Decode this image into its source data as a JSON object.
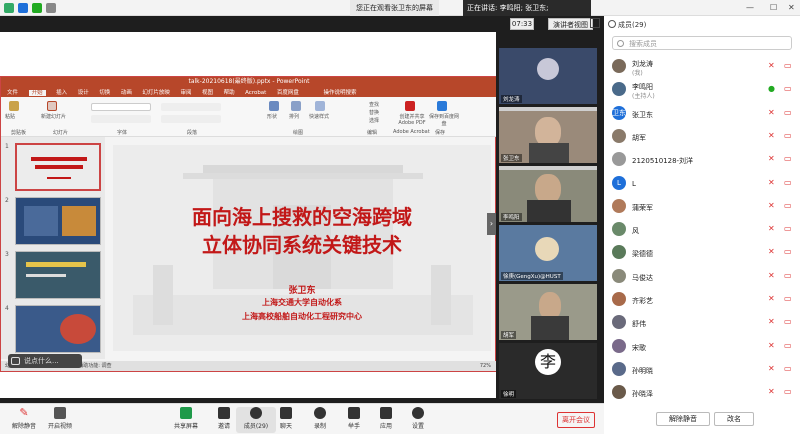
{
  "top": {
    "viewing_banner": "您正在观看张卫东的屏幕",
    "speaking": "正在讲话: 李鸣阳; 张卫东;",
    "clock": "07:33",
    "view_mode": "演讲者视图"
  },
  "ppt": {
    "title": "talk-20210618(最终版).pptx - PowerPoint",
    "tabs": [
      "文件",
      "开始",
      "插入",
      "设计",
      "切换",
      "动画",
      "幻灯片放映",
      "审阅",
      "视图",
      "帮助",
      "Acrobat",
      "百度网盘"
    ],
    "active_tab": "开始",
    "tell_me": "操作说明搜索",
    "ribbon_groups": [
      "剪贴板",
      "幻灯片",
      "字体",
      "段落",
      "绘图",
      "编辑",
      "Adobe Acrobat",
      "保存"
    ],
    "ribbon_buttons": [
      "粘贴",
      "新建幻灯片",
      "形状",
      "排列",
      "快速样式",
      "查找",
      "替换",
      "选择",
      "创建并共享 Adobe PDF",
      "保存到百度网盘"
    ],
    "thumb_numbers": [
      "1",
      "2",
      "3",
      "4"
    ],
    "slide": {
      "title_line1": "面向海上搜救的空海跨域",
      "title_line2": "立体协同系统关键技术",
      "author": "张卫东",
      "affiliation1": "上海交通大学自动化系",
      "affiliation2": "上海高校船舶自动化工程研究中心"
    },
    "status_left": "幻灯片 第1张，共 ...  中文(中国)  辅助功能: 调查",
    "zoom": "72%"
  },
  "chat_hint": "说点什么...",
  "videos": [
    {
      "name": "刘龙涛"
    },
    {
      "name": "张卫东"
    },
    {
      "name": "李鸣阳"
    },
    {
      "name": "徐庚(GengXu)@HUST"
    },
    {
      "name": "胡军"
    },
    {
      "name": "徐明"
    }
  ],
  "panel": {
    "title": "成员(29)",
    "search_placeholder": "搜索成员",
    "members": [
      {
        "name": "刘龙涛",
        "sub": "(我)",
        "avatar": "",
        "color": "#7a6a5a"
      },
      {
        "name": "李鸣阳",
        "sub": "(主持人)",
        "avatar": "",
        "color": "#4a6a8a"
      },
      {
        "name": "张卫东",
        "sub": "",
        "avatar": "卫东",
        "color": "#1e6fd9"
      },
      {
        "name": "胡军",
        "sub": "",
        "avatar": "",
        "color": "#8a7a6a"
      },
      {
        "name": "2120510128-刘洋",
        "sub": "",
        "avatar": "",
        "color": "#999999"
      },
      {
        "name": "L",
        "sub": "",
        "avatar": "L",
        "color": "#1e6fd9"
      },
      {
        "name": "蒲荣军",
        "sub": "",
        "avatar": "",
        "color": "#b07a5a"
      },
      {
        "name": "风",
        "sub": "",
        "avatar": "",
        "color": "#6a8a6a"
      },
      {
        "name": "梁德德",
        "sub": "",
        "avatar": "",
        "color": "#5a7a5a"
      },
      {
        "name": "马俊达",
        "sub": "",
        "avatar": "",
        "color": "#8a8a7a"
      },
      {
        "name": "齐彩艺",
        "sub": "",
        "avatar": "",
        "color": "#a86a4a"
      },
      {
        "name": "舒伟",
        "sub": "",
        "avatar": "",
        "color": "#6a6a7a"
      },
      {
        "name": "宋歌",
        "sub": "",
        "avatar": "",
        "color": "#7a6a8a"
      },
      {
        "name": "孙明晓",
        "sub": "",
        "avatar": "",
        "color": "#5a6a8a"
      },
      {
        "name": "孙晓泽",
        "sub": "",
        "avatar": "",
        "color": "#6a5a4a"
      }
    ],
    "unmute_all": "解除静音",
    "rename": "改名"
  },
  "toolbar": {
    "mute": "解除静音",
    "video": "开启视频",
    "share": "共享屏幕",
    "invite": "邀请",
    "members": "成员(29)",
    "chat": "聊天",
    "record": "录制",
    "raise_hand": "举手",
    "apps": "应用",
    "settings": "设置",
    "end": "离开会议"
  }
}
